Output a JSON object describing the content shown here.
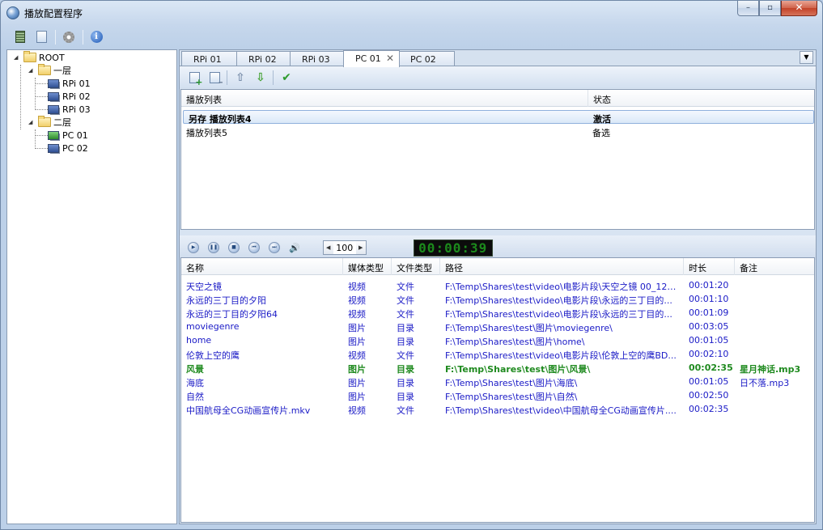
{
  "window": {
    "title": "播放配置程序",
    "controls": {
      "minimize": "–",
      "maximize": "▫",
      "close": "✕"
    }
  },
  "toolbar": {
    "icons": [
      "film-icon",
      "page-icon",
      "gear-icon",
      "info-icon"
    ],
    "info_glyph": "i"
  },
  "tree": {
    "root": "ROOT",
    "groups": [
      {
        "label": "一层",
        "children": [
          "RPi 01",
          "RPi 02",
          "RPi 03"
        ]
      },
      {
        "label": "二层",
        "children": [
          "PC 01",
          "PC 02"
        ]
      }
    ]
  },
  "tabs": {
    "items": [
      "RPi 01",
      "RPi 02",
      "RPi 03",
      "PC 01",
      "PC 02"
    ],
    "active": "PC 01",
    "close_glyph": "✕",
    "dropdown_glyph": "▼"
  },
  "playlist_toolbar": {
    "up_glyph": "⇧",
    "down_glyph": "⇩",
    "check_glyph": "✔"
  },
  "playlists": {
    "columns": [
      "播放列表",
      "状态"
    ],
    "rows": [
      {
        "name": "另存 播放列表4",
        "status": "激活"
      },
      {
        "name": "播放列表5",
        "status": "备选"
      }
    ]
  },
  "player": {
    "buttons": [
      "▶",
      "❚❚",
      "■",
      "⏮",
      "⏭"
    ],
    "volume_glyph": "🔊",
    "step_left": "◀",
    "step_right": "▶",
    "volume_value": "100",
    "clock": "00:00:39"
  },
  "media": {
    "columns": [
      "名称",
      "媒体类型",
      "文件类型",
      "路径",
      "时长",
      "备注"
    ],
    "rows": [
      {
        "name": "天空之镜",
        "media": "视频",
        "file": "文件",
        "path": "F:\\Temp\\Shares\\test\\video\\电影片段\\天空之镜 00_12_...",
        "duration": "00:01:20",
        "note": ""
      },
      {
        "name": "永远的三丁目的夕阳",
        "media": "视频",
        "file": "文件",
        "path": "F:\\Temp\\Shares\\test\\video\\电影片段\\永远的三丁目的...",
        "duration": "00:01:10",
        "note": ""
      },
      {
        "name": "永远的三丁目的夕阳64",
        "media": "视频",
        "file": "文件",
        "path": "F:\\Temp\\Shares\\test\\video\\电影片段\\永远的三丁目的...",
        "duration": "00:01:09",
        "note": ""
      },
      {
        "name": "moviegenre",
        "media": "图片",
        "file": "目录",
        "path": "F:\\Temp\\Shares\\test\\图片\\moviegenre\\",
        "duration": "00:03:05",
        "note": ""
      },
      {
        "name": "home",
        "media": "图片",
        "file": "目录",
        "path": "F:\\Temp\\Shares\\test\\图片\\home\\",
        "duration": "00:01:05",
        "note": ""
      },
      {
        "name": "伦敦上空的鹰",
        "media": "视频",
        "file": "文件",
        "path": "F:\\Temp\\Shares\\test\\video\\电影片段\\伦敦上空的鹰BD...",
        "duration": "00:02:10",
        "note": ""
      },
      {
        "name": "风景",
        "media": "图片",
        "file": "目录",
        "path": "F:\\Temp\\Shares\\test\\图片\\风景\\",
        "duration": "00:02:35",
        "note": "星月神话.mp3"
      },
      {
        "name": "海底",
        "media": "图片",
        "file": "目录",
        "path": "F:\\Temp\\Shares\\test\\图片\\海底\\",
        "duration": "00:01:05",
        "note": "日不落.mp3"
      },
      {
        "name": "自然",
        "media": "图片",
        "file": "目录",
        "path": "F:\\Temp\\Shares\\test\\图片\\自然\\",
        "duration": "00:02:50",
        "note": ""
      },
      {
        "name": "中国航母全CG动画宣传片.mkv",
        "media": "视频",
        "file": "文件",
        "path": "F:\\Temp\\Shares\\test\\video\\中国航母全CG动画宣传片....",
        "duration": "00:02:35",
        "note": ""
      }
    ],
    "current_index": 6
  },
  "colors": {
    "link_blue": "#1a1ac6",
    "playing_green": "#1f8a1f",
    "clock_green": "#1c8a1c"
  }
}
